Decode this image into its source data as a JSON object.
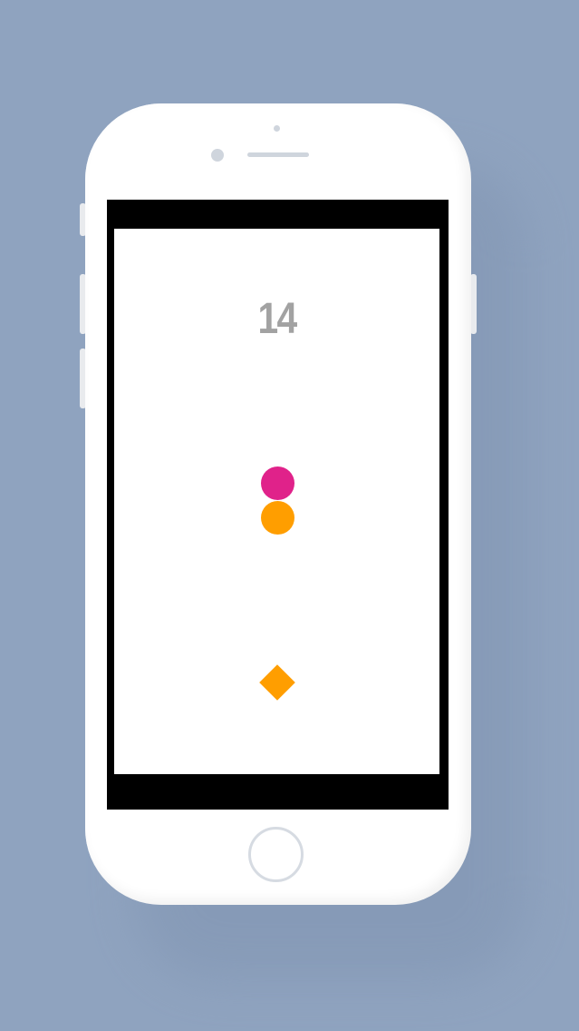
{
  "game": {
    "score": "14"
  },
  "colors": {
    "background": "#8fa3bf",
    "score_text": "#a2a2a2",
    "ball_top": "#e0228a",
    "ball_bottom": "#ff9e00",
    "diamond": "#ff9e00"
  },
  "icons": {
    "home_button": "home-button",
    "front_camera": "front-camera-icon"
  }
}
